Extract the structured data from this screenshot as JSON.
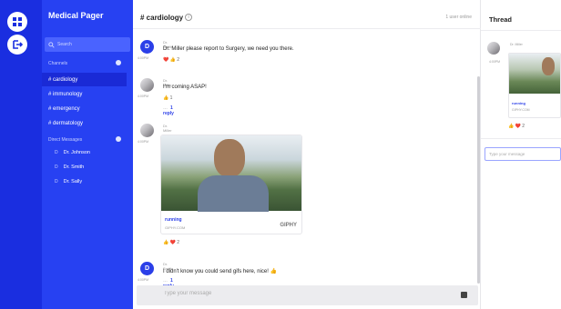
{
  "rail": {
    "home_icon": "grid-icon",
    "logout_icon": "logout-icon"
  },
  "sidebar": {
    "title": "Medical Pager",
    "search_placeholder": "Search",
    "channels_label": "Channels",
    "channels": [
      "# cardiology",
      "# immunology",
      "# emergency",
      "# dermatology"
    ],
    "active_channel_index": 0,
    "dm_label": "Direct Messages",
    "dms": [
      {
        "initial": "D",
        "name": "Dr. Johnson"
      },
      {
        "initial": "D",
        "name": "Dr. Smith"
      },
      {
        "initial": "D",
        "name": "Dr. Sally"
      }
    ]
  },
  "header": {
    "channel": "# cardiology",
    "online": "1 user online"
  },
  "messages": [
    {
      "avatar": "D",
      "time": "4:00PM",
      "author": "Dr. Smith",
      "text": "Dr. Miller please report to Surgery, we need you there.",
      "reactions": "❤️ 👍 2"
    },
    {
      "avatar": "",
      "time": "4:00PM",
      "author": "Dr. Miller",
      "text": "I'm coming ASAP!",
      "reactions": "👍 1",
      "reply": "1 reply"
    },
    {
      "avatar": "",
      "time": "4:00PM",
      "author": "Dr. Miller",
      "gif_title": "running",
      "gif_source": "GIPHY.COM",
      "gif_brand": "GIPHY",
      "reactions": "👍 ❤️ 2"
    },
    {
      "avatar": "D",
      "time": "4:00PM",
      "author": "Dr. Smith",
      "text": "I didn't know you could send gifs here, nice! 👍",
      "reply": "1 reply"
    }
  ],
  "composer": {
    "placeholder": "Type your message"
  },
  "thread": {
    "title": "Thread",
    "author": "Dr. Miller",
    "time": "4:00PM",
    "gif_title": "running",
    "gif_source": "GIPHY.COM",
    "reactions": "👍 ❤️ 2",
    "input_placeholder": "Type your message"
  },
  "colors": {
    "rail": "#1a2ee0",
    "sidebar": "#2741f2",
    "accent": "#2b3fe8"
  }
}
